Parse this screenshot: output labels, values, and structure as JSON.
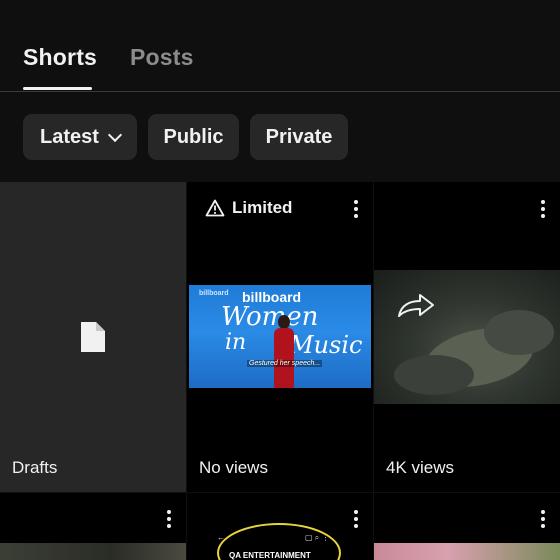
{
  "tabs": [
    {
      "label": "Shorts",
      "active": true
    },
    {
      "label": "Posts",
      "active": false
    }
  ],
  "filters": {
    "latest_label": "Latest",
    "public_label": "Public",
    "private_label": "Private"
  },
  "grid": {
    "drafts": {
      "label": "Drafts",
      "icon": "document-icon"
    },
    "item1": {
      "status_label": "Limited",
      "status_icon": "warning-icon",
      "views": "No views",
      "thumb": {
        "logo": "billboard",
        "heading": "billboard",
        "line1": "Women",
        "line2": "in",
        "line3": "Music",
        "subtitle": "Gestured her speech..."
      }
    },
    "item2": {
      "views": "4K views"
    },
    "item3": {},
    "item4": {
      "thumb": {
        "banner": "QA ENTERTAINMENT"
      }
    },
    "item5": {}
  },
  "colors": {
    "background": "#0f0f0f",
    "chip": "#272727",
    "active_tab": "#f1f1f1",
    "inactive_tab": "#8c8c8c"
  }
}
